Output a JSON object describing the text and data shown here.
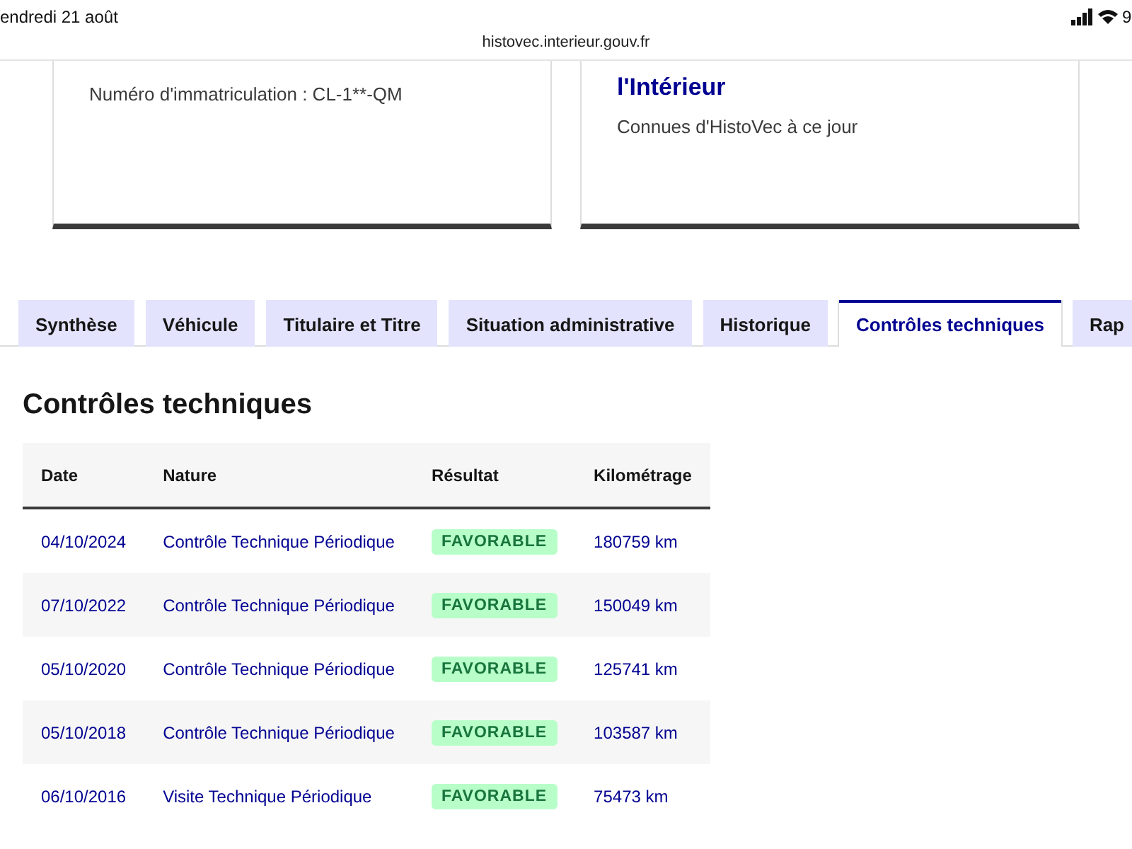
{
  "status_bar": {
    "date": "endredi 21 août",
    "battery": "9"
  },
  "address_bar": {
    "url": "histovec.interieur.gouv.fr"
  },
  "cards": [
    {
      "subtitle": "Numéro d'immatriculation : CL-1**-QM"
    },
    {
      "title": "l'Intérieur",
      "subtitle": "Connues d'HistoVec à ce jour"
    }
  ],
  "tabs": [
    {
      "label": "Synthèse",
      "selected": false
    },
    {
      "label": "Véhicule",
      "selected": false
    },
    {
      "label": "Titulaire et Titre",
      "selected": false
    },
    {
      "label": "Situation administrative",
      "selected": false
    },
    {
      "label": "Historique",
      "selected": false
    },
    {
      "label": "Contrôles techniques",
      "selected": true
    },
    {
      "label": "Rap",
      "selected": false
    }
  ],
  "panel": {
    "heading": "Contrôles techniques",
    "table": {
      "columns": [
        "Date",
        "Nature",
        "Résultat",
        "Kilométrage"
      ],
      "rows": [
        {
          "date": "04/10/2024",
          "nature": "Contrôle Technique Périodique",
          "result": "FAVORABLE",
          "mileage": "180759 km"
        },
        {
          "date": "07/10/2022",
          "nature": "Contrôle Technique Périodique",
          "result": "FAVORABLE",
          "mileage": "150049 km"
        },
        {
          "date": "05/10/2020",
          "nature": "Contrôle Technique Périodique",
          "result": "FAVORABLE",
          "mileage": "125741 km"
        },
        {
          "date": "05/10/2018",
          "nature": "Contrôle Technique Périodique",
          "result": "FAVORABLE",
          "mileage": "103587 km"
        },
        {
          "date": "06/10/2016",
          "nature": "Visite Technique Périodique",
          "result": "FAVORABLE",
          "mileage": "75473 km"
        }
      ]
    }
  }
}
